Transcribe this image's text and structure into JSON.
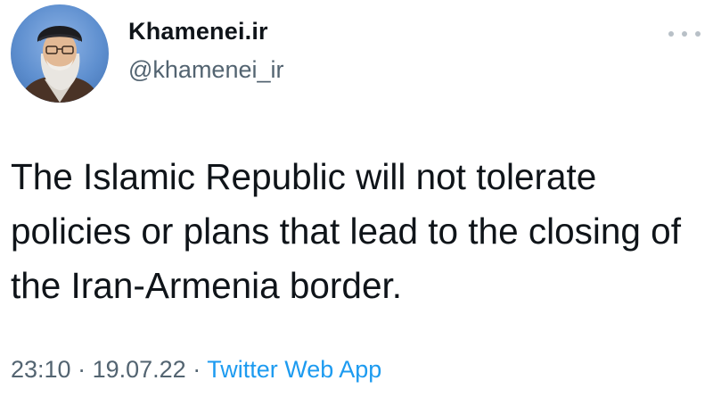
{
  "user": {
    "display_name": "Khamenei.ir",
    "handle": "@khamenei_ir"
  },
  "tweet": {
    "text": "The Islamic Republic will not tolerate policies or plans that lead to the closing of the Iran-Armenia border."
  },
  "meta": {
    "time": "23:10",
    "separator": " · ",
    "date": "19.07.22",
    "source": "Twitter Web App"
  },
  "colors": {
    "text": "#0f1419",
    "muted": "#536471",
    "link": "#1d9bf0"
  },
  "icons": {
    "more": "more-horizontal-icon"
  }
}
